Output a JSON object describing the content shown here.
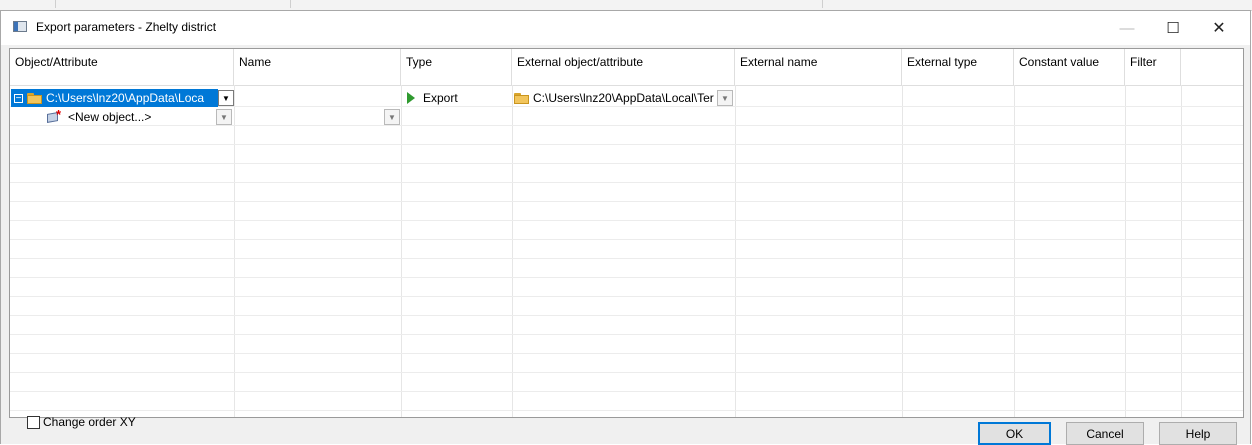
{
  "window": {
    "title": "Export parameters - Zhelty district",
    "minimize": "—",
    "maximize": "☐",
    "close": "✕"
  },
  "grid": {
    "columns": [
      "Object/Attribute",
      "Name",
      "Type",
      "External object/attribute",
      "External name",
      "External type",
      "Constant value",
      "Filter"
    ],
    "rows": [
      {
        "object": "C:\\Users\\lnz20\\AppData\\Loca",
        "name": "",
        "type": "Export",
        "external_object": "C:\\Users\\lnz20\\AppData\\Local\\Ter",
        "selected": true,
        "icon": "folder-icon"
      },
      {
        "object": "<New object...>",
        "name": "",
        "type": "",
        "external_object": "",
        "selected": false,
        "icon": "new-object-icon"
      }
    ],
    "expand_glyph": "−",
    "dropdown_glyph": "▼"
  },
  "footer": {
    "checkbox_label": "Change order XY",
    "checkbox_checked": false,
    "ok_label": "OK",
    "cancel_label": "Cancel",
    "help_label": "Help"
  },
  "colors": {
    "selection": "#0078d7",
    "export_arrow": "#2f9a2f",
    "folder": "#f2c55c"
  }
}
